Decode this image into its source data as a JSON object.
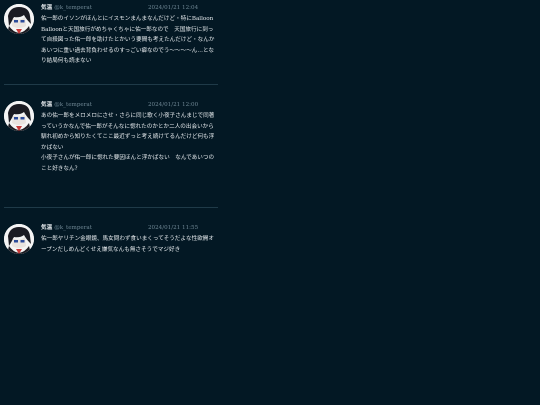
{
  "posts": [
    {
      "name": "気温",
      "handle": "@k_temperat",
      "timestamp": "2024/01/21 12:04",
      "lines": [
        "佑一郎のイソンがほんとにイスモンまんまなんだけど・特にBalloon Balloonと天国旅行がめちゃくちゃに佑一郎なので　天国旅行に到って自殺図った佑一郎を助けたとかいう要間も考えたんだけど・なんかあいつに重い過去背負わせるのすっごい癖なのでう～～～～ん…となり結局何も読まない"
      ]
    },
    {
      "name": "気温",
      "handle": "@k_temperat",
      "timestamp": "2024/01/21 12:00",
      "lines": [
        "あの佑一郎をメロメロにさせ・さらに同じ歌く小夜子さんまじで同著っていうかなんで佑一郎がそんなに惚れたのかとか二人の出会いから馴れ初めから知りたくてここ最近ずっと考え続けてるんだけど何も浮かばない",
        "小夜子さんが佑一郎に惚れた要因ほんと浮かばない　なんであいつのこと好きなん？"
      ]
    },
    {
      "name": "気温",
      "handle": "@k_temperat",
      "timestamp": "2024/01/21 11:55",
      "lines": [
        "佑一郎ヤリチン金眼鏡、馬女問わず食いまくってそうだよな性欲開オープンだしめんどくせえ嫌気なんも無さそうでマジ好き"
      ]
    }
  ]
}
